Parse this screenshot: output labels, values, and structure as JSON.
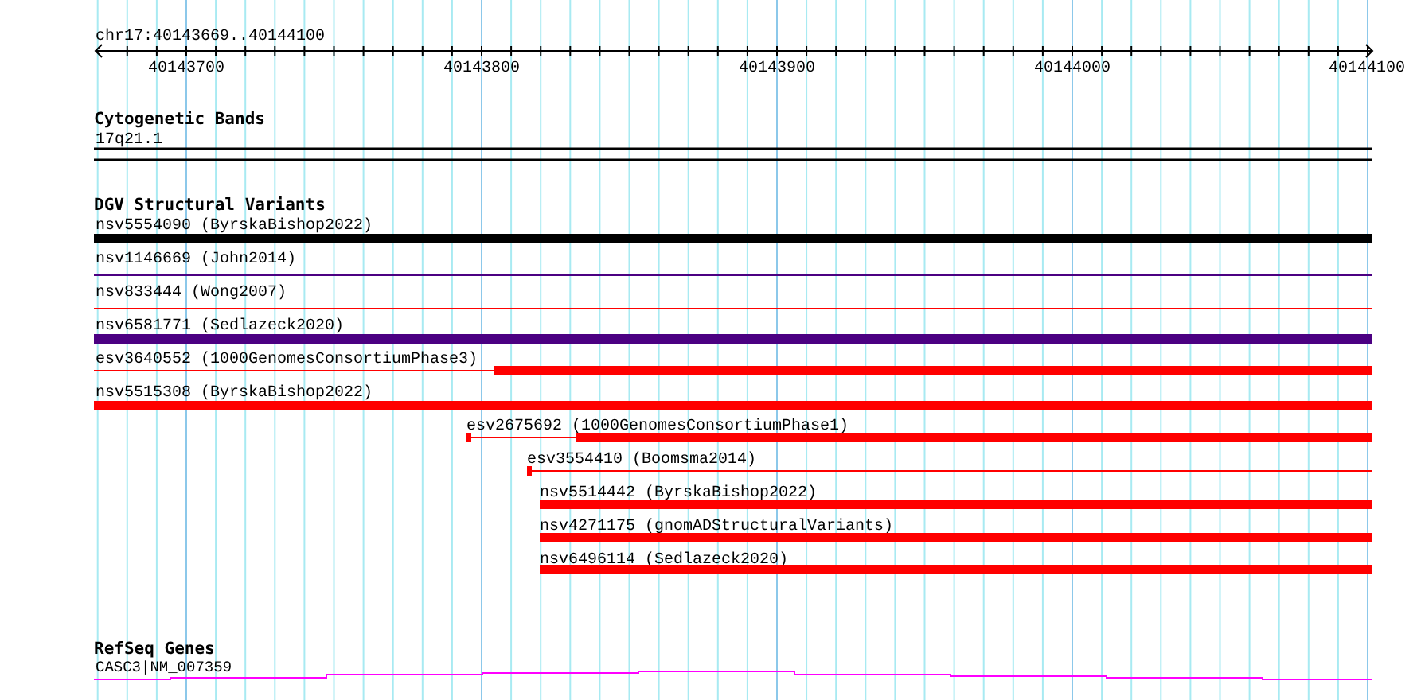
{
  "ruler": {
    "region": "chr17:40143669..40144100",
    "tick_labels": [
      "40143700",
      "40143800",
      "40143900",
      "40144000",
      "40144100"
    ]
  },
  "cytogenetic_bands": {
    "title": "Cytogenetic Bands",
    "band": "17q21.1"
  },
  "dgv_structural_variants": {
    "title": "DGV Structural Variants",
    "variants": [
      {
        "label": "nsv5554090 (ByrskaBishop2022)",
        "kind": "thick",
        "color": "#000000"
      },
      {
        "label": "nsv1146669 (John2014)",
        "kind": "thin",
        "color": "#4b0082"
      },
      {
        "label": "nsv833444 (Wong2007)",
        "kind": "thin",
        "color": "#ff0000"
      },
      {
        "label": "nsv6581771 (Sedlazeck2020)",
        "kind": "thick",
        "color": "#4b0082"
      },
      {
        "label": "esv3640552 (1000GenomesConsortiumPhase3)",
        "kind": "thin-thick",
        "color": "#ff0000"
      },
      {
        "label": "nsv5515308 (ByrskaBishop2022)",
        "kind": "thick",
        "color": "#ff0000"
      },
      {
        "label": "esv2675692 (1000GenomesConsortiumPhase1)",
        "kind": "block-thin-thick",
        "color": "#ff0000"
      },
      {
        "label": "esv3554410 (Boomsma2014)",
        "kind": "block-thin",
        "color": "#ff0000"
      },
      {
        "label": "nsv5514442 (ByrskaBishop2022)",
        "kind": "thick",
        "color": "#ff0000"
      },
      {
        "label": "nsv4271175 (gnomADStructuralVariants)",
        "kind": "thick",
        "color": "#ff0000"
      },
      {
        "label": "nsv6496114 (Sedlazeck2020)",
        "kind": "thick",
        "color": "#ff0000"
      }
    ]
  },
  "refseq_genes": {
    "title": "RefSeq Genes",
    "transcript": "CASC3|NM_007359"
  }
}
